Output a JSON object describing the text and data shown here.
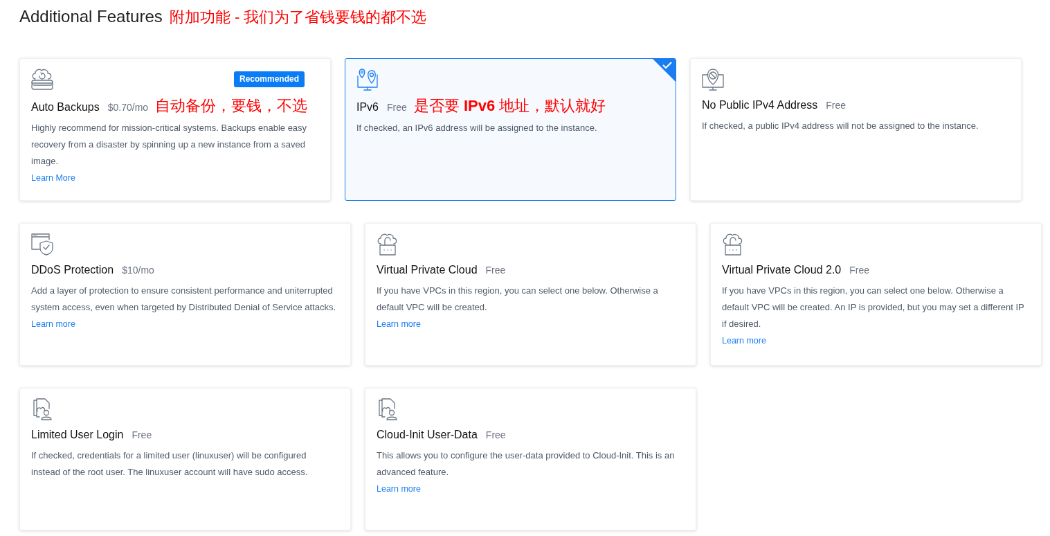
{
  "header": {
    "title": "Additional Features",
    "annotation": "附加功能 - 我们为了省钱要钱的都不选"
  },
  "rows": [
    [
      {
        "kind": "backup",
        "title": "Auto Backups",
        "price": "$0.70/mo",
        "annotation": "自动备份，要钱，不选",
        "badge": "Recommended",
        "selected": false,
        "description": "Highly recommend for mission-critical systems. Backups enable easy recovery from a disaster by spinning up a new instance from a saved image.",
        "link": "Learn More"
      },
      {
        "kind": "ipv6",
        "title": "IPv6",
        "price": "Free",
        "annotation": "是否要 **IPv6** 地址，默认就好",
        "selected": true,
        "description": "If checked, an IPv6 address will be assigned to the instance."
      },
      {
        "kind": "noipv4",
        "title": "No Public IPv4 Address",
        "price": "Free",
        "selected": false,
        "description": "If checked, a public IPv4 address will not be assigned to the instance."
      }
    ],
    [
      {
        "kind": "ddos",
        "title": "DDoS Protection",
        "price": "$10/mo",
        "selected": false,
        "description": "Add a layer of protection to ensure consistent performance and uniterrupted system access, even when targeted by Distributed Denial of Service attacks.",
        "link": "Learn more"
      },
      {
        "kind": "vpc",
        "title": "Virtual Private Cloud",
        "price": "Free",
        "selected": false,
        "description": "If you have VPCs in this region, you can select one below. Otherwise a default VPC will be created.",
        "link": "Learn more"
      },
      {
        "kind": "vpc",
        "title": "Virtual Private Cloud 2.0",
        "price": "Free",
        "selected": false,
        "description": "If you have VPCs in this region, you can select one below. Otherwise a default VPC will be created. An IP is provided, but you may set a different IP if desired.",
        "link": "Learn more"
      }
    ],
    [
      {
        "kind": "user",
        "title": "Limited User Login",
        "price": "Free",
        "selected": false,
        "description": "If checked, credentials for a limited user (linuxuser) will be configured instead of the root user. The linuxuser account will have sudo access."
      },
      {
        "kind": "user",
        "title": "Cloud-Init User-Data",
        "price": "Free",
        "selected": false,
        "description": "This allows you to configure the user-data provided to Cloud-Init. This is an advanced feature.",
        "link": "Learn more"
      }
    ]
  ]
}
